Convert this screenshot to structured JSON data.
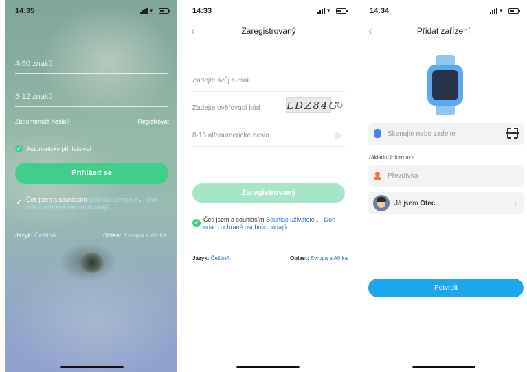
{
  "screen1": {
    "time": "14:35",
    "account_placeholder": "4-50 znaků",
    "password_placeholder": "6-12 znaků",
    "forgot_label": "Zapomenuté heslo?",
    "register_label": "Registrovat",
    "auto_login_label": "Automaticky přihlašovat",
    "login_button": "Přihlásit se",
    "agree_prefix": "Četl jsem a souhlasím ",
    "agree_link1": "Souhlas uživatele",
    "agree_sep": " 、 ",
    "agree_link2a": "Doh",
    "agree_link2b": "oda o ochraně osobních údajů",
    "lang_label": "Jazyk: ",
    "lang_value": "ČeštinA",
    "region_label": "Oblast: ",
    "region_value": "Evropa a Afrika"
  },
  "screen2": {
    "time": "14:33",
    "title": "Zaregistrovaný",
    "email_placeholder": "Zadejte svůj e-mail",
    "code_placeholder": "Zadejte ověřovací kód",
    "captcha_text": "LDZ84G",
    "password_placeholder": "8-16 alfanumerické heslo",
    "register_button": "Zaregistrovaný",
    "agree_prefix": "Četl jsem a souhlasím ",
    "agree_link1": "Souhlas uživatele",
    "agree_sep": " 、 ",
    "agree_link2a": "Doh",
    "agree_link2b": "oda o ochraně osobních údajů",
    "lang_label": "Jazyk: ",
    "lang_value": "ČeštinA",
    "region_label": "Oblast: ",
    "region_value": "Evropa a Afrika"
  },
  "screen3": {
    "time": "14:34",
    "title": "Přidat zařízení",
    "scan_placeholder": "Skenujte nebo zadejte",
    "section_label": "základní informace",
    "nickname_placeholder": "Přezdívka",
    "relation_prefix": "Já jsem ",
    "relation_value": "Otec",
    "confirm_button": "Potvrdit"
  },
  "colors": {
    "green_primary": "#3fcf8a",
    "green_disabled": "#a6e6c8",
    "blue_primary": "#1da6ec",
    "link_blue": "#2a73c9"
  },
  "icons": {
    "back": "chevron-left-icon",
    "refresh": "refresh-icon",
    "eye": "eye-icon",
    "scan": "scan-icon",
    "chevron": "chevron-right-icon"
  }
}
